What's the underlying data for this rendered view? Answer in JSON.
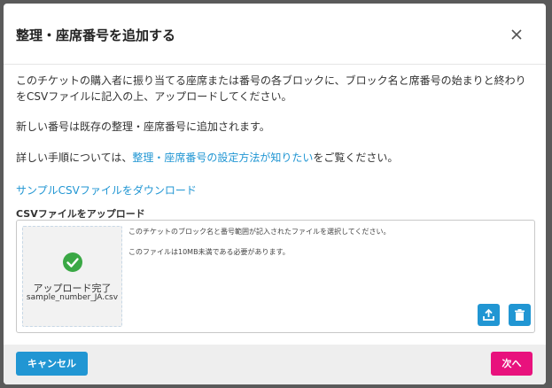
{
  "modal": {
    "title": "整理・座席番号を追加する",
    "close_icon": "close-icon"
  },
  "body": {
    "paragraph1": "このチケットの購入者に振り当てる座席または番号の各ブロックに、ブロック名と席番号の始まりと終わりをCSVファイルに記入の上、アップロードしてください。",
    "paragraph2": "新しい番号は既存の整理・座席番号に追加されます。",
    "paragraph3_before": "詳しい手順については、",
    "paragraph3_link": "整理・座席番号の設定方法が知りたい",
    "paragraph3_after": "をご覧ください。",
    "download_link": "サンプルCSVファイルをダウンロード",
    "upload_label": "CSVファイルをアップロード"
  },
  "upload": {
    "status_text": "アップロード完了",
    "file_name": "sample_number_JA.csv",
    "description1": "このチケットのブロック名と番号範囲が記入されたファイルを選択してください。",
    "description2": "このファイルは10MB未満である必要があります。",
    "icons": {
      "status": "check-circle-icon",
      "upload": "upload-icon",
      "delete": "trash-icon"
    }
  },
  "footer": {
    "cancel_label": "キャンセル",
    "next_label": "次へ"
  },
  "colors": {
    "primary": "#2196d3",
    "next": "#e8127d",
    "success": "#3aa845"
  }
}
